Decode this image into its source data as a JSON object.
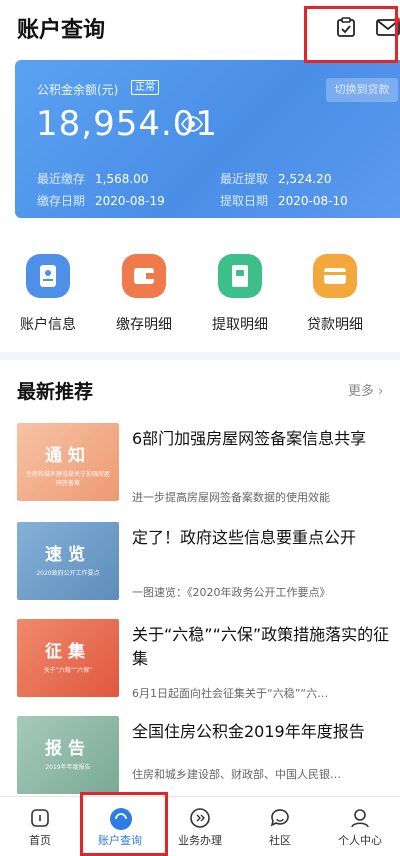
{
  "header": {
    "title": "账户查询",
    "icons": [
      "clipboard-check-icon",
      "mail-icon"
    ]
  },
  "balance_card": {
    "label": "公积金余额(元)",
    "badge": "正常",
    "balance": "18,954.01",
    "switch_button": "切换到贷款",
    "recent_deposit_label": "最近缴存",
    "recent_deposit_value": "1,568.00",
    "deposit_date_label": "缴存日期",
    "deposit_date_value": "2020-08-19",
    "recent_withdraw_label": "最近提取",
    "recent_withdraw_value": "2,524.20",
    "withdraw_date_label": "提取日期",
    "withdraw_date_value": "2020-08-10",
    "colors": {
      "gradient_start": "#5aa2f2",
      "gradient_end": "#4a8ee6"
    }
  },
  "quick_actions": [
    {
      "label": "账户信息",
      "icon": "account-info-icon",
      "color": "#4e8fe8"
    },
    {
      "label": "缴存明细",
      "icon": "wallet-icon",
      "color": "#ef7b4c"
    },
    {
      "label": "提取明细",
      "icon": "withdraw-doc-icon",
      "color": "#3dbf8a"
    },
    {
      "label": "贷款明细",
      "icon": "loan-card-icon",
      "color": "#f4a73b"
    }
  ],
  "recommend": {
    "title": "最新推荐",
    "more": "更多 ›",
    "items": [
      {
        "thumb_title": "通知",
        "thumb_sub": "住房和城乡建设部关于加强房屋网签备案",
        "title": "6部门加强房屋网签备案信息共享",
        "desc": "进一步提高房屋网签备案数据的使用效能",
        "thumb_color": "#f3b08c"
      },
      {
        "thumb_title": "速览",
        "thumb_sub": "2020政府公开工作要点",
        "title": "定了！政府这些信息要重点公开",
        "desc": "一图速览：《2020年政务公开工作要点》",
        "thumb_color": "#6f9fc8"
      },
      {
        "thumb_title": "征集",
        "thumb_sub": "关于“六稳”“六保”",
        "title": "关于“六稳”“六保”政策措施落实的征集",
        "desc": "6月1日起面向社会征集关于“六稳”“六…",
        "thumb_color": "#e86f55"
      },
      {
        "thumb_title": "报告",
        "thumb_sub": "2019年年度报告",
        "title": "全国住房公积金2019年年度报告",
        "desc": "住房和城乡建设部、财政部、中国人民银…",
        "thumb_color": "#8fb9a8"
      }
    ]
  },
  "bottom_nav": {
    "items": [
      {
        "label": "首页",
        "icon": "home-icon"
      },
      {
        "label": "账户查询",
        "icon": "account-query-icon"
      },
      {
        "label": "业务办理",
        "icon": "business-icon"
      },
      {
        "label": "社区",
        "icon": "community-icon"
      },
      {
        "label": "个人中心",
        "icon": "profile-icon"
      }
    ],
    "active_color": "#2d7be5"
  }
}
